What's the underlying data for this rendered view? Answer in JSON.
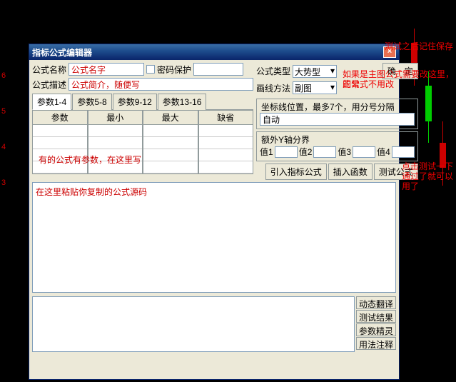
{
  "background_notes": {
    "top_right": "测试之后记住保存",
    "right_1": "如果是主图公式需要改这里，正常",
    "right_2": "的公式不用改",
    "test_note": "点击测试一下\n通过了就可以\n用了"
  },
  "window": {
    "title": "指标公式编辑器"
  },
  "labels": {
    "formula_name": "公式名称",
    "password": "密码保护",
    "formula_type": "公式类型",
    "formula_desc": "公式描述",
    "draw_method": "画线方法",
    "confirm": "确　定",
    "coord_hint": "坐标线位置，最多7个，用分号分隔",
    "extra_y": "额外Y轴分界",
    "val1": "值1",
    "val2": "值2",
    "val3": "值3",
    "val4": "值4",
    "import_formula": "引入指标公式",
    "insert_func": "插入函数",
    "test_formula": "测试公式",
    "param_tab1": "参数1-4",
    "param_tab2": "参数5-8",
    "param_tab3": "参数9-12",
    "param_tab4": "参数13-16",
    "col_param": "参数",
    "col_min": "最小",
    "col_max": "最大",
    "col_default": "缺省",
    "dyn_translate": "动态翻译",
    "test_tool": "测试结果",
    "param_wizard": "参数精灵",
    "usage_note": "用法注释"
  },
  "values": {
    "name": "公式名字",
    "desc": "公式简介，随便写",
    "type_sel": "大势型",
    "draw_sel": "副图",
    "coord": "自动",
    "param_hint": "有的公式有参数，在这里写",
    "code": "在这里粘贴你复制的公式源码"
  },
  "axis": {
    "y1": "6",
    "y2": "5",
    "y3": "4",
    "y4": "3"
  }
}
